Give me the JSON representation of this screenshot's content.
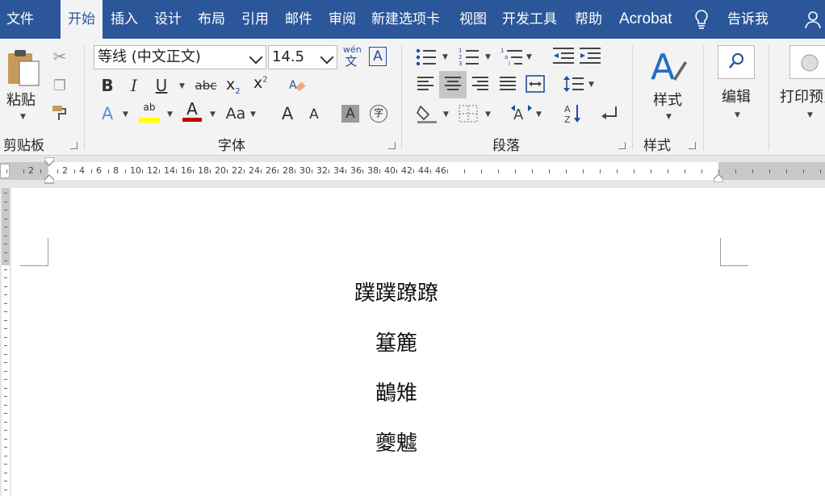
{
  "tabs": [
    {
      "label": "文件",
      "active": false
    },
    {
      "label": "开始",
      "active": true
    },
    {
      "label": "插入",
      "active": false
    },
    {
      "label": "设计",
      "active": false
    },
    {
      "label": "布局",
      "active": false
    },
    {
      "label": "引用",
      "active": false
    },
    {
      "label": "邮件",
      "active": false
    },
    {
      "label": "审阅",
      "active": false
    },
    {
      "label": "新建选项卡",
      "active": false
    },
    {
      "label": "视图",
      "active": false
    },
    {
      "label": "开发工具",
      "active": false
    },
    {
      "label": "帮助",
      "active": false
    },
    {
      "label": "Acrobat",
      "active": false
    }
  ],
  "tell_me": "告诉我",
  "clipboard": {
    "paste_label": "粘贴",
    "group_label": "剪贴板"
  },
  "font": {
    "name": "等线 (中文正文)",
    "size": "14.5",
    "phonetic_top": "wén",
    "phonetic_bottom": "文",
    "border_char": "A",
    "group_label": "字体",
    "bold": "B",
    "italic": "I",
    "underline": "U",
    "strike": "abc",
    "sub": "x",
    "sup": "x",
    "aa": "Aa",
    "grow": "A",
    "shrink": "A",
    "shade": "A",
    "enclose": "字",
    "ab": "ab",
    "color_a": "A"
  },
  "paragraph": {
    "group_label": "段落"
  },
  "styles": {
    "label": "样式",
    "group_label": "样式"
  },
  "editing": {
    "label": "编辑"
  },
  "print_preview": {
    "label": "打印预览"
  },
  "ruler": {
    "labels": [
      "2",
      "2",
      "4",
      "6",
      "8",
      "10",
      "12",
      "14",
      "16",
      "18",
      "20",
      "22",
      "24",
      "26",
      "28",
      "30",
      "32",
      "34",
      "36",
      "38",
      "40",
      "42",
      "44",
      "46"
    ]
  },
  "document": {
    "lines": [
      "蹼蹼蹽蹽",
      "簊簏",
      "鶓雉",
      "夔魖"
    ]
  },
  "colors": {
    "ribbon_blue": "#2b579a",
    "highlight": "#ffff00",
    "font_color": "#c00000"
  }
}
